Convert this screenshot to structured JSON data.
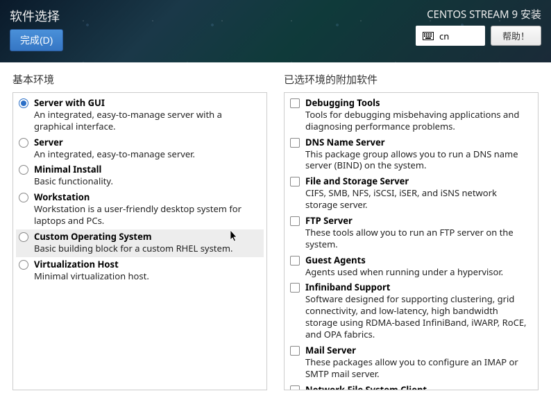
{
  "header": {
    "page_title": "软件选择",
    "done_label": "完成(D)",
    "installer_title": "CENTOS STREAM 9 安装",
    "lang": "cn",
    "help_label": "帮助！"
  },
  "left": {
    "title": "基本环境",
    "items": [
      {
        "label": "Server with GUI",
        "desc": "An integrated, easy-to-manage server with a graphical interface.",
        "selected": true
      },
      {
        "label": "Server",
        "desc": "An integrated, easy-to-manage server.",
        "selected": false
      },
      {
        "label": "Minimal Install",
        "desc": "Basic functionality.",
        "selected": false
      },
      {
        "label": "Workstation",
        "desc": "Workstation is a user-friendly desktop system for laptops and PCs.",
        "selected": false
      },
      {
        "label": "Custom Operating System",
        "desc": "Basic building block for a custom RHEL system.",
        "selected": false,
        "hover": true
      },
      {
        "label": "Virtualization Host",
        "desc": "Minimal virtualization host.",
        "selected": false
      }
    ]
  },
  "right": {
    "title": "已选环境的附加软件",
    "items": [
      {
        "label": "Debugging Tools",
        "desc": "Tools for debugging misbehaving applications and diagnosing performance problems."
      },
      {
        "label": "DNS Name Server",
        "desc": "This package group allows you to run a DNS name server (BIND) on the system."
      },
      {
        "label": "File and Storage Server",
        "desc": "CIFS, SMB, NFS, iSCSI, iSER, and iSNS network storage server."
      },
      {
        "label": "FTP Server",
        "desc": "These tools allow you to run an FTP server on the system."
      },
      {
        "label": "Guest Agents",
        "desc": "Agents used when running under a hypervisor."
      },
      {
        "label": "Infiniband Support",
        "desc": "Software designed for supporting clustering, grid connectivity, and low-latency, high bandwidth storage using RDMA-based InfiniBand, iWARP, RoCE, and OPA fabrics."
      },
      {
        "label": "Mail Server",
        "desc": "These packages allow you to configure an IMAP or SMTP mail server."
      },
      {
        "label": "Network File System Client",
        "desc": ""
      }
    ]
  }
}
